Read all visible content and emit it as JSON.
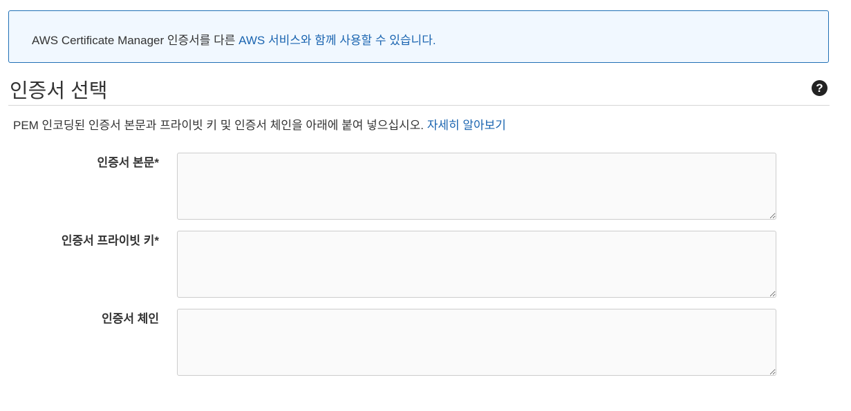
{
  "info": {
    "text_before": "AWS Certificate Manager 인증서를 다른 ",
    "link_text": "AWS 서비스와 함께 사용할 수 있습니다."
  },
  "section": {
    "title": "인증서 선택",
    "help_icon": "question-circle-icon"
  },
  "description": {
    "text": "PEM 인코딩된 인증서 본문과 프라이빗 키 및 인증서 체인을 아래에 붙여 넣으십시오. ",
    "link_text": "자세히 알아보기"
  },
  "fields": [
    {
      "label": "인증서 본문*",
      "value": ""
    },
    {
      "label": "인증서 프라이빗 키*",
      "value": ""
    },
    {
      "label": "인증서 체인",
      "value": ""
    }
  ]
}
